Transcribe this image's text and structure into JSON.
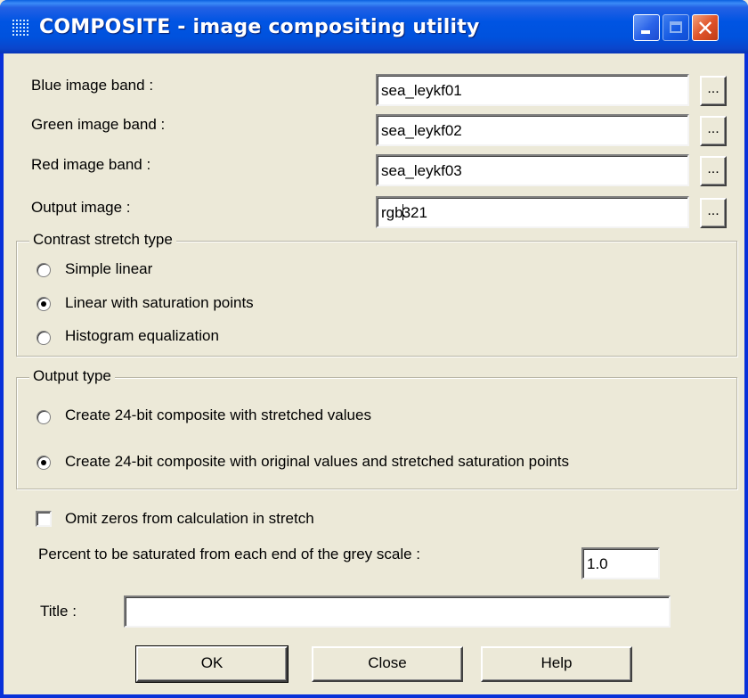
{
  "window": {
    "title": "COMPOSITE - image compositing utility"
  },
  "bands": [
    {
      "label": "Blue image band :",
      "value": "sea_leykf01",
      "browse": "..."
    },
    {
      "label": "Green image band :",
      "value": "sea_leykf02",
      "browse": "..."
    },
    {
      "label": "Red image band :",
      "value": "sea_leykf03",
      "browse": "..."
    }
  ],
  "output_image": {
    "label": "Output image :",
    "value_before_cursor": "rgb",
    "value_after_cursor": "321",
    "browse": "..."
  },
  "contrast": {
    "title": "Contrast stretch type",
    "options": [
      {
        "label": "Simple linear",
        "checked": false
      },
      {
        "label": "Linear with saturation points",
        "checked": true
      },
      {
        "label": "Histogram equalization",
        "checked": false
      }
    ]
  },
  "output_type": {
    "title": "Output type",
    "options": [
      {
        "label": "Create 24-bit composite with stretched values",
        "checked": false
      },
      {
        "label": "Create 24-bit composite with original values and stretched saturation points",
        "checked": true
      }
    ]
  },
  "omit_zeros": {
    "label": "Omit zeros from calculation in stretch",
    "checked": false
  },
  "percent": {
    "label": "Percent to be saturated from each end of the grey scale :",
    "value": "1.0"
  },
  "title_field": {
    "label": "Title :",
    "value": ""
  },
  "buttons": {
    "ok": "OK",
    "close": "Close",
    "help": "Help"
  }
}
